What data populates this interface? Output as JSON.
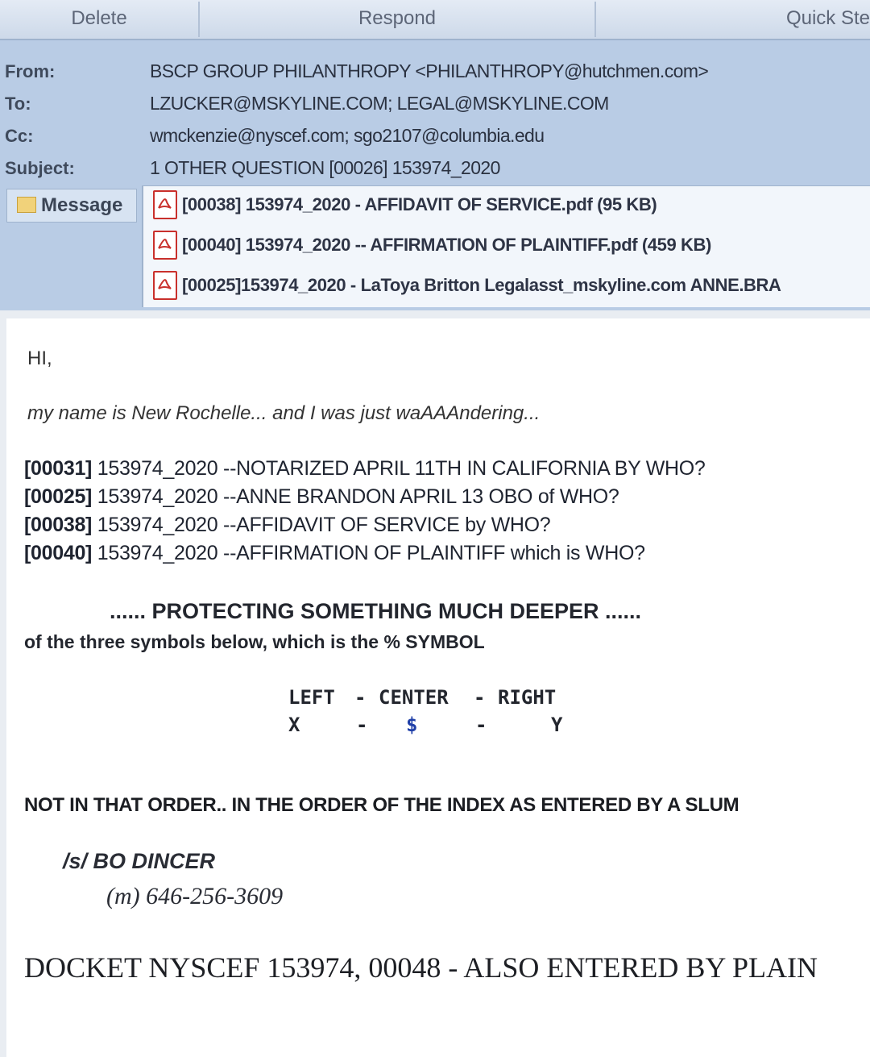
{
  "toolbar": {
    "delete_label": "Delete",
    "respond_label": "Respond",
    "quick_steps_label": "Quick Ste"
  },
  "header": {
    "from_label": "From:",
    "from_value": "BSCP GROUP PHILANTHROPY <PHILANTHROPY@hutchmen.com>",
    "to_label": "To:",
    "to_value": "LZUCKER@MSKYLINE.COM; LEGAL@MSKYLINE.COM",
    "cc_label": "Cc:",
    "cc_value": "wmckenzie@nyscef.com; sgo2107@columbia.edu",
    "subject_label": "Subject:",
    "subject_value": "1 OTHER QUESTION [00026] 153974_2020",
    "message_tab_label": "Message",
    "attachments": [
      {
        "name": "[00038] 153974_2020 - AFFIDAVIT OF SERVICE.pdf (95 KB)"
      },
      {
        "name": "[00040] 153974_2020 -- AFFIRMATION OF PLAINTIFF.pdf (459 KB)"
      },
      {
        "name": "[00025]153974_2020 - LaToya Britton Legalasst_mskyline.com ANNE.BRA"
      }
    ]
  },
  "body": {
    "greeting": "HI,",
    "intro": "my name is New Rochelle... and I was just waAAAndering...",
    "index_lines": [
      {
        "id": "[00031]",
        "case": "153974_2020",
        "text": "--NOTARIZED APRIL 11TH IN CALIFORNIA BY WHO?"
      },
      {
        "id": "[00025]",
        "case": "153974_2020",
        "text": "--ANNE BRANDON APRIL 13 OBO of WHO?"
      },
      {
        "id": "[00038]",
        "case": "153974_2020",
        "text": "--AFFIDAVIT OF SERVICE by WHO?"
      },
      {
        "id": "[00040]",
        "case": "153974_2020",
        "text": "--AFFIRMATION OF PLAINTIFF which is WHO?"
      }
    ],
    "protecting": "...... PROTECTING SOMETHING MUCH DEEPER ......",
    "symbol_question": "of the three symbols below, which is the % SYMBOL",
    "symbols": {
      "left_label": "LEFT",
      "center_label": "CENTER",
      "right_label": "RIGHT",
      "dash": "-",
      "left_value": "X",
      "center_value": "$",
      "right_value": "Y",
      "center_color": "#1f3fa8"
    },
    "not_in_order": "NOT IN THAT ORDER.. IN THE ORDER OF THE INDEX AS ENTERED BY A SLUM",
    "signature": "/s/ BO DINCER",
    "mobile": "(m) 646-256-3609",
    "docket": "DOCKET NYSCEF 153974, 00048 - ALSO ENTERED BY PLAIN"
  }
}
